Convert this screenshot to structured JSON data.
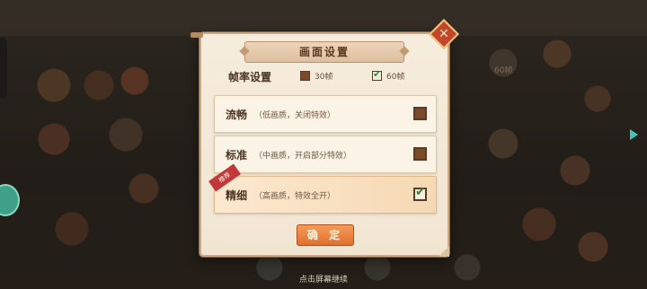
{
  "dialog": {
    "title": "画面设置",
    "close_symbol": "✕",
    "fps": {
      "label": "帧率设置",
      "options": [
        {
          "label": "30帧",
          "checked": false
        },
        {
          "label": "60帧",
          "checked": true
        }
      ]
    },
    "quality_options": [
      {
        "name": "流畅",
        "desc": "（低画质，关闭特效）",
        "checked": false
      },
      {
        "name": "标准",
        "desc": "（中画质，开启部分特效）",
        "checked": false
      },
      {
        "name": "精细",
        "desc": "（高画质，特效全开）",
        "checked": true,
        "badge": "推荐"
      }
    ],
    "confirm_label": "确 定"
  },
  "background": {
    "fps_text": "60帧"
  },
  "continue_hint": "点击屏幕继续",
  "icons": {
    "close": "close-icon",
    "check": "check-icon",
    "arrow": "play-arrow-icon"
  },
  "colors": {
    "accent_orange": "#e0702f",
    "check_green": "#2f8a3e",
    "close_red": "#c2462c"
  }
}
